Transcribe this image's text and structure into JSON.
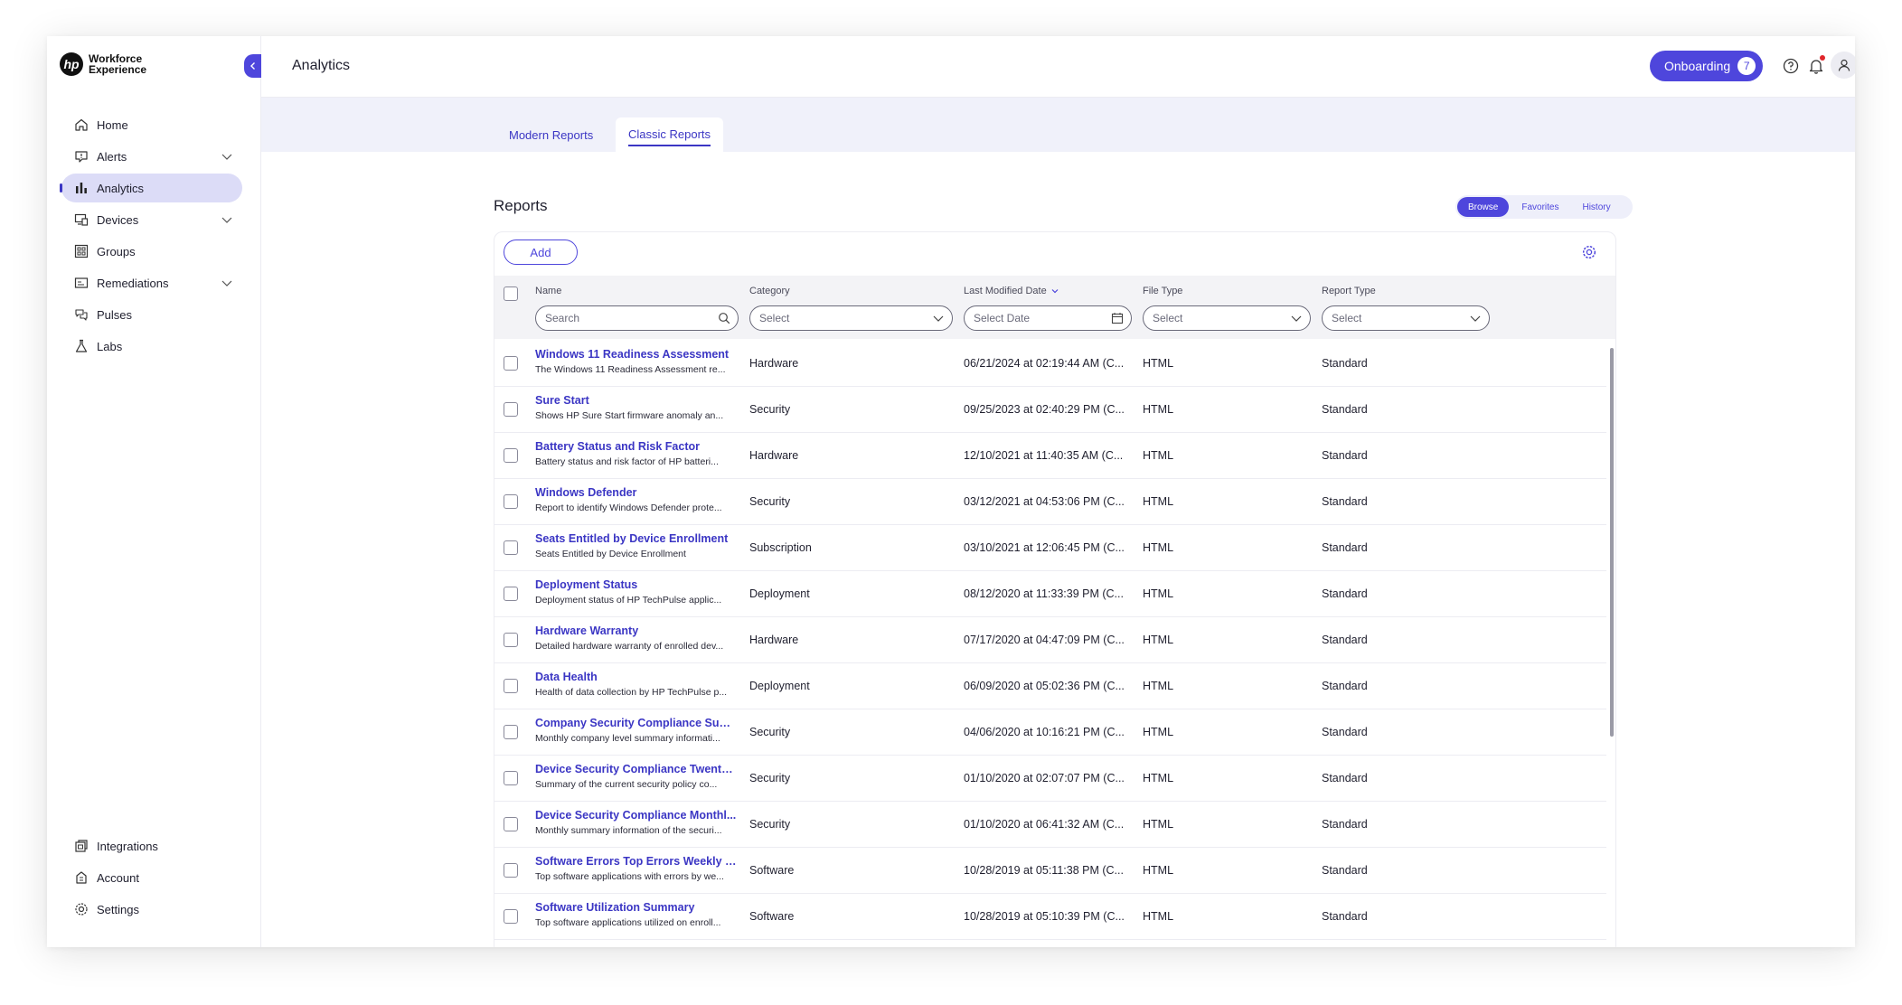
{
  "brand": {
    "logo_text": "hp",
    "line1": "Workforce",
    "line2": "Experience"
  },
  "sidebar": {
    "items": [
      {
        "label": "Home",
        "icon": "home-icon"
      },
      {
        "label": "Alerts",
        "icon": "alert-icon",
        "expandable": true
      },
      {
        "label": "Analytics",
        "icon": "analytics-icon",
        "active": true
      },
      {
        "label": "Devices",
        "icon": "devices-icon",
        "expandable": true
      },
      {
        "label": "Groups",
        "icon": "groups-icon"
      },
      {
        "label": "Remediations",
        "icon": "remediations-icon",
        "expandable": true
      },
      {
        "label": "Pulses",
        "icon": "pulses-icon"
      },
      {
        "label": "Labs",
        "icon": "labs-icon"
      }
    ],
    "bottom_items": [
      {
        "label": "Integrations",
        "icon": "integrations-icon"
      },
      {
        "label": "Account",
        "icon": "account-icon"
      },
      {
        "label": "Settings",
        "icon": "settings-icon"
      }
    ]
  },
  "header": {
    "title": "Analytics",
    "onboarding_label": "Onboarding",
    "onboarding_count": "7"
  },
  "tabs": [
    {
      "label": "Modern Reports",
      "active": false
    },
    {
      "label": "Classic Reports",
      "active": true
    }
  ],
  "reports": {
    "title": "Reports",
    "view_toggle": [
      {
        "label": "Browse",
        "active": true
      },
      {
        "label": "Favorites",
        "active": false
      },
      {
        "label": "History",
        "active": false
      }
    ],
    "add_label": "Add",
    "columns": {
      "name": "Name",
      "category": "Category",
      "last_modified": "Last Modified Date",
      "file_type": "File Type",
      "report_type": "Report Type"
    },
    "filters": {
      "search_placeholder": "Search",
      "category": "Select",
      "date": "Select Date",
      "file_type": "Select",
      "report_type": "Select"
    },
    "rows": [
      {
        "name": "Windows 11 Readiness Assessment",
        "desc": "The Windows 11 Readiness Assessment re...",
        "category": "Hardware",
        "date": "06/21/2024 at 02:19:44 AM (C...",
        "file_type": "HTML",
        "report_type": "Standard"
      },
      {
        "name": "Sure Start",
        "desc": "Shows HP Sure Start firmware anomaly an...",
        "category": "Security",
        "date": "09/25/2023 at 02:40:29 PM (C...",
        "file_type": "HTML",
        "report_type": "Standard"
      },
      {
        "name": "Battery Status and Risk Factor",
        "desc": "Battery status and risk factor of HP batteri...",
        "category": "Hardware",
        "date": "12/10/2021 at 11:40:35 AM (C...",
        "file_type": "HTML",
        "report_type": "Standard"
      },
      {
        "name": "Windows Defender",
        "desc": "Report to identify Windows Defender prote...",
        "category": "Security",
        "date": "03/12/2021 at 04:53:06 PM (C...",
        "file_type": "HTML",
        "report_type": "Standard"
      },
      {
        "name": "Seats Entitled by Device Enrollment",
        "desc": "Seats Entitled by Device Enrollment",
        "category": "Subscription",
        "date": "03/10/2021 at 12:06:45 PM (C...",
        "file_type": "HTML",
        "report_type": "Standard"
      },
      {
        "name": "Deployment Status",
        "desc": "Deployment status of HP TechPulse applic...",
        "category": "Deployment",
        "date": "08/12/2020 at 11:33:39 PM (C...",
        "file_type": "HTML",
        "report_type": "Standard"
      },
      {
        "name": "Hardware Warranty",
        "desc": "Detailed hardware warranty of enrolled dev...",
        "category": "Hardware",
        "date": "07/17/2020 at 04:47:09 PM (C...",
        "file_type": "HTML",
        "report_type": "Standard"
      },
      {
        "name": "Data Health",
        "desc": "Health of data collection by HP TechPulse p...",
        "category": "Deployment",
        "date": "06/09/2020 at 05:02:36 PM (C...",
        "file_type": "HTML",
        "report_type": "Standard"
      },
      {
        "name": "Company Security Compliance Sum...",
        "desc": "Monthly company level summary informati...",
        "category": "Security",
        "date": "04/06/2020 at 10:16:21 PM (C...",
        "file_type": "HTML",
        "report_type": "Standard"
      },
      {
        "name": "Device Security Compliance Twenty ...",
        "desc": "Summary of the current security policy co...",
        "category": "Security",
        "date": "01/10/2020 at 02:07:07 PM (C...",
        "file_type": "HTML",
        "report_type": "Standard"
      },
      {
        "name": "Device Security Compliance Monthl...",
        "desc": "Monthly summary information of the securi...",
        "category": "Security",
        "date": "01/10/2020 at 06:41:32 AM (C...",
        "file_type": "HTML",
        "report_type": "Standard"
      },
      {
        "name": "Software Errors Top Errors Weekly S...",
        "desc": "Top software applications with errors by we...",
        "category": "Software",
        "date": "10/28/2019 at 05:11:38 PM (C...",
        "file_type": "HTML",
        "report_type": "Standard"
      },
      {
        "name": "Software Utilization Summary",
        "desc": "Top software applications utilized on enroll...",
        "category": "Software",
        "date": "10/28/2019 at 05:10:39 PM (C...",
        "file_type": "HTML",
        "report_type": "Standard"
      }
    ]
  },
  "colors": {
    "accent": "#4e46dc",
    "link": "#3b36c4",
    "tab_band": "#f0f1fa",
    "active_nav": "#dcdcf7",
    "notification_dot": "#e0262b"
  }
}
